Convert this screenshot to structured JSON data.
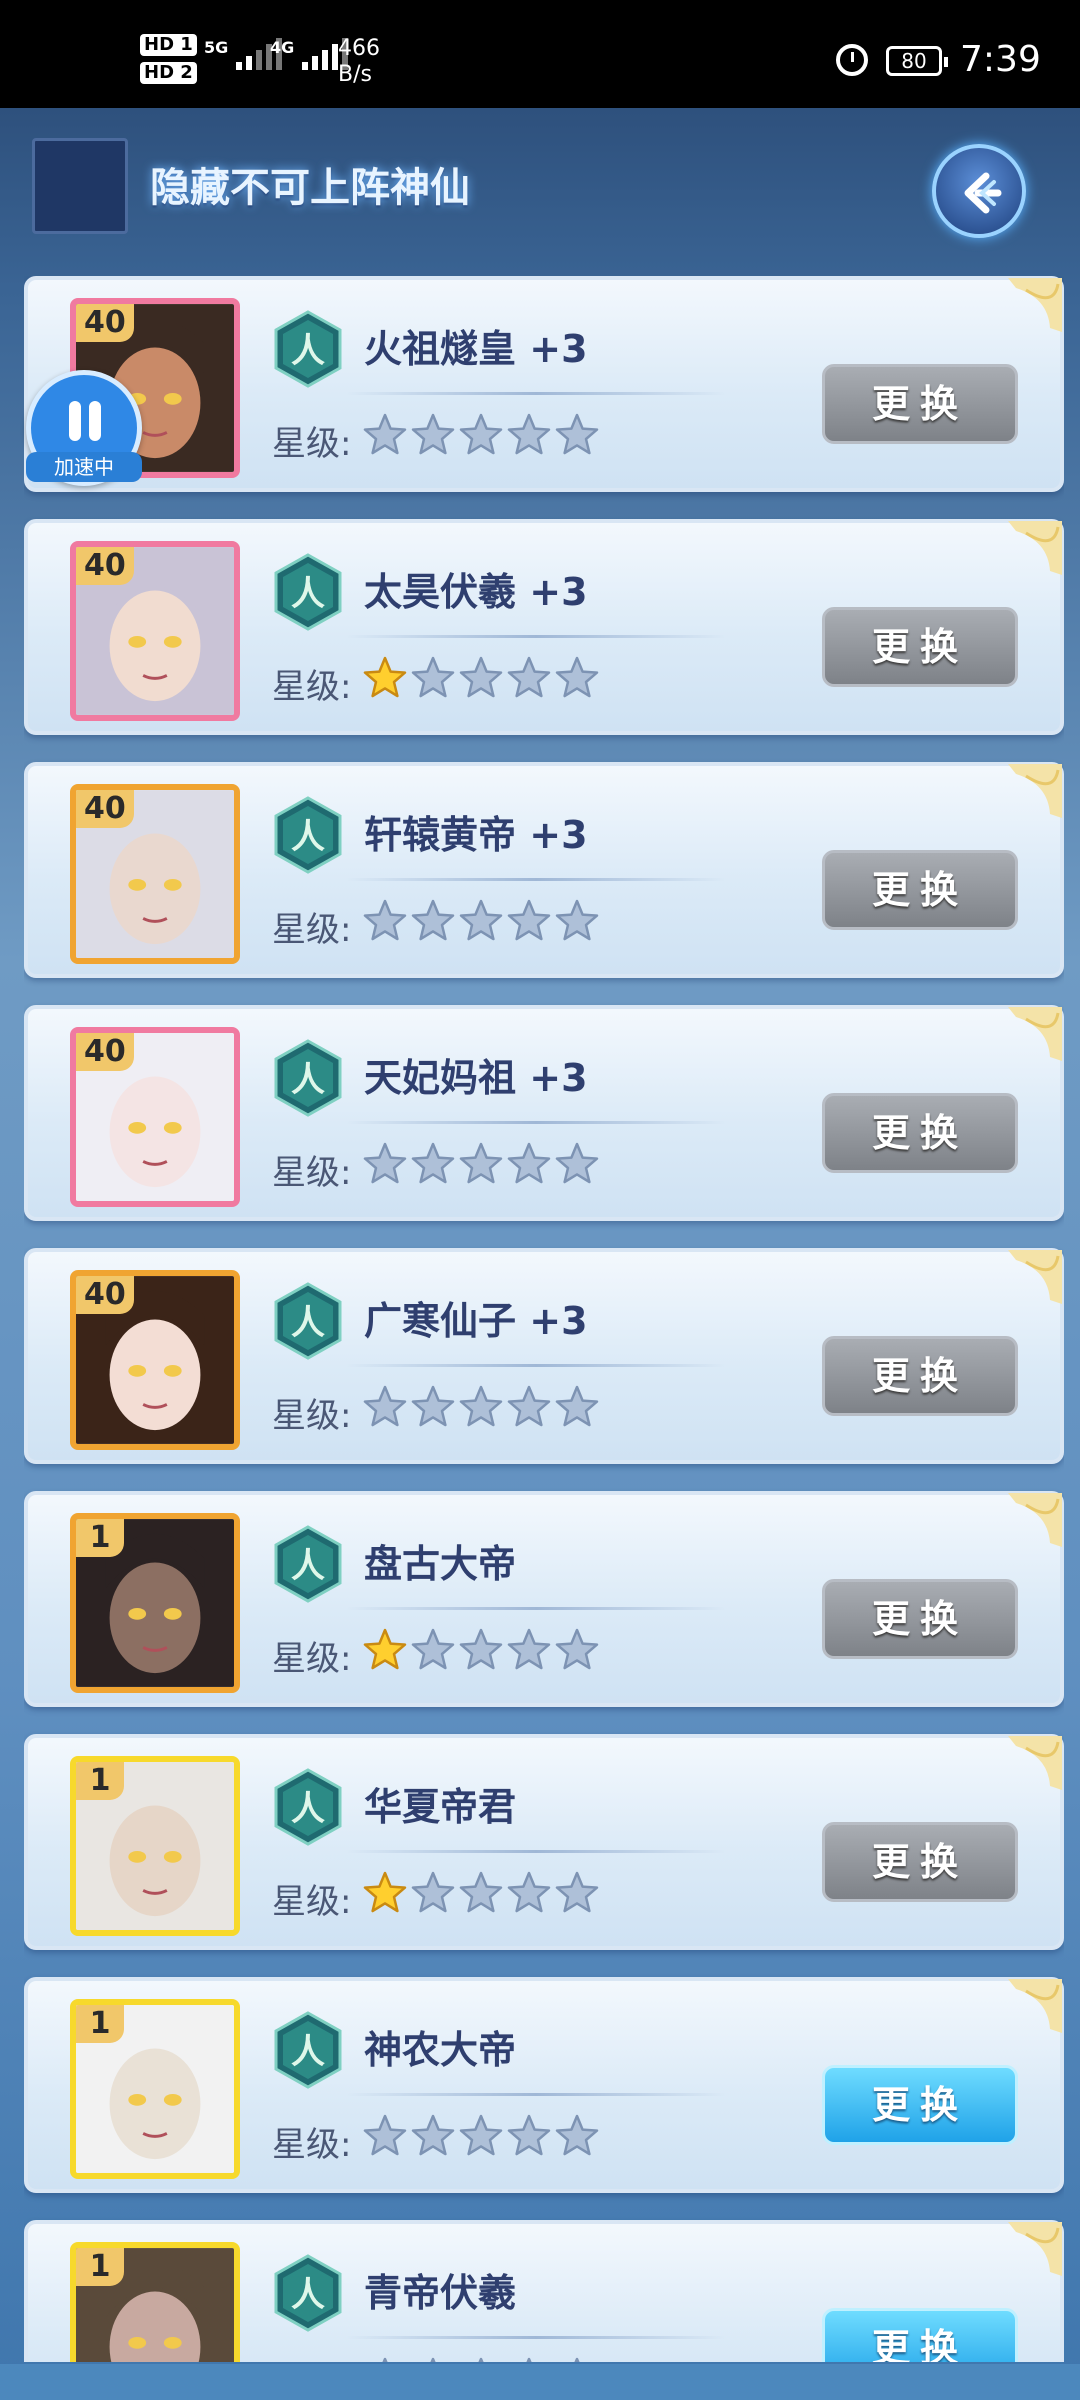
{
  "status_bar": {
    "hd1": "HD 1",
    "hd2": "HD 2",
    "net1": "5G",
    "net2": "4G",
    "speed_value": "466",
    "speed_unit": "B/s",
    "battery": "80",
    "time": "7:39"
  },
  "header": {
    "title": "隐藏不可上阵神仙",
    "back_icon": "back-arrow-icon"
  },
  "accelerate": {
    "label": "加速中",
    "icon": "pause-icon"
  },
  "star_label": "星级:",
  "swap_label": "更换",
  "colors": {
    "swap_gray": "#8a8e94",
    "swap_blue": "#26a8ec",
    "name_text": "#2f3f6f",
    "star_gold": "#ffcf2e",
    "star_empty": "#aec0d8"
  },
  "cards": [
    {
      "level": "40",
      "name": "火祖燧皇 +3",
      "stars": 0,
      "frame": "pink",
      "button": "gray"
    },
    {
      "level": "40",
      "name": "太昊伏羲 +3",
      "stars": 1,
      "frame": "pink",
      "button": "gray"
    },
    {
      "level": "40",
      "name": "轩辕黄帝 +3",
      "stars": 0,
      "frame": "orange",
      "button": "gray"
    },
    {
      "level": "40",
      "name": "天妃妈祖 +3",
      "stars": 0,
      "frame": "pink",
      "button": "gray"
    },
    {
      "level": "40",
      "name": "广寒仙子 +3",
      "stars": 0,
      "frame": "orange",
      "button": "gray"
    },
    {
      "level": "1",
      "name": "盘古大帝",
      "stars": 1,
      "frame": "orange",
      "button": "gray"
    },
    {
      "level": "1",
      "name": "华夏帝君",
      "stars": 1,
      "frame": "yellow",
      "button": "gray"
    },
    {
      "level": "1",
      "name": "神农大帝",
      "stars": 0,
      "frame": "yellow",
      "button": "blue"
    },
    {
      "level": "1",
      "name": "青帝伏羲",
      "stars": 0,
      "frame": "yellow",
      "button": "blue"
    }
  ],
  "emblem_char": "人"
}
